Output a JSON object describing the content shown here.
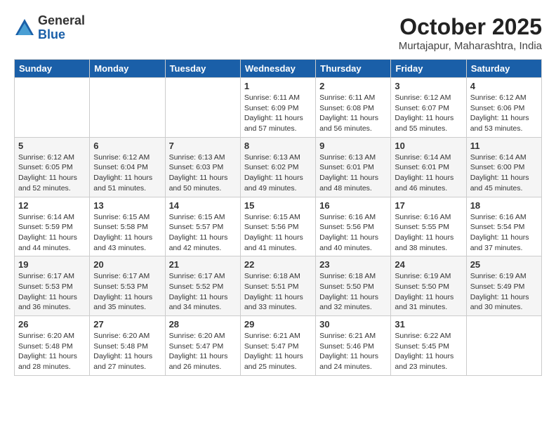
{
  "header": {
    "logo_general": "General",
    "logo_blue": "Blue",
    "month_title": "October 2025",
    "location": "Murtajapur, Maharashtra, India"
  },
  "days_of_week": [
    "Sunday",
    "Monday",
    "Tuesday",
    "Wednesday",
    "Thursday",
    "Friday",
    "Saturday"
  ],
  "weeks": [
    [
      {
        "day": "",
        "info": ""
      },
      {
        "day": "",
        "info": ""
      },
      {
        "day": "",
        "info": ""
      },
      {
        "day": "1",
        "info": "Sunrise: 6:11 AM\nSunset: 6:09 PM\nDaylight: 11 hours\nand 57 minutes."
      },
      {
        "day": "2",
        "info": "Sunrise: 6:11 AM\nSunset: 6:08 PM\nDaylight: 11 hours\nand 56 minutes."
      },
      {
        "day": "3",
        "info": "Sunrise: 6:12 AM\nSunset: 6:07 PM\nDaylight: 11 hours\nand 55 minutes."
      },
      {
        "day": "4",
        "info": "Sunrise: 6:12 AM\nSunset: 6:06 PM\nDaylight: 11 hours\nand 53 minutes."
      }
    ],
    [
      {
        "day": "5",
        "info": "Sunrise: 6:12 AM\nSunset: 6:05 PM\nDaylight: 11 hours\nand 52 minutes."
      },
      {
        "day": "6",
        "info": "Sunrise: 6:12 AM\nSunset: 6:04 PM\nDaylight: 11 hours\nand 51 minutes."
      },
      {
        "day": "7",
        "info": "Sunrise: 6:13 AM\nSunset: 6:03 PM\nDaylight: 11 hours\nand 50 minutes."
      },
      {
        "day": "8",
        "info": "Sunrise: 6:13 AM\nSunset: 6:02 PM\nDaylight: 11 hours\nand 49 minutes."
      },
      {
        "day": "9",
        "info": "Sunrise: 6:13 AM\nSunset: 6:01 PM\nDaylight: 11 hours\nand 48 minutes."
      },
      {
        "day": "10",
        "info": "Sunrise: 6:14 AM\nSunset: 6:01 PM\nDaylight: 11 hours\nand 46 minutes."
      },
      {
        "day": "11",
        "info": "Sunrise: 6:14 AM\nSunset: 6:00 PM\nDaylight: 11 hours\nand 45 minutes."
      }
    ],
    [
      {
        "day": "12",
        "info": "Sunrise: 6:14 AM\nSunset: 5:59 PM\nDaylight: 11 hours\nand 44 minutes."
      },
      {
        "day": "13",
        "info": "Sunrise: 6:15 AM\nSunset: 5:58 PM\nDaylight: 11 hours\nand 43 minutes."
      },
      {
        "day": "14",
        "info": "Sunrise: 6:15 AM\nSunset: 5:57 PM\nDaylight: 11 hours\nand 42 minutes."
      },
      {
        "day": "15",
        "info": "Sunrise: 6:15 AM\nSunset: 5:56 PM\nDaylight: 11 hours\nand 41 minutes."
      },
      {
        "day": "16",
        "info": "Sunrise: 6:16 AM\nSunset: 5:56 PM\nDaylight: 11 hours\nand 40 minutes."
      },
      {
        "day": "17",
        "info": "Sunrise: 6:16 AM\nSunset: 5:55 PM\nDaylight: 11 hours\nand 38 minutes."
      },
      {
        "day": "18",
        "info": "Sunrise: 6:16 AM\nSunset: 5:54 PM\nDaylight: 11 hours\nand 37 minutes."
      }
    ],
    [
      {
        "day": "19",
        "info": "Sunrise: 6:17 AM\nSunset: 5:53 PM\nDaylight: 11 hours\nand 36 minutes."
      },
      {
        "day": "20",
        "info": "Sunrise: 6:17 AM\nSunset: 5:53 PM\nDaylight: 11 hours\nand 35 minutes."
      },
      {
        "day": "21",
        "info": "Sunrise: 6:17 AM\nSunset: 5:52 PM\nDaylight: 11 hours\nand 34 minutes."
      },
      {
        "day": "22",
        "info": "Sunrise: 6:18 AM\nSunset: 5:51 PM\nDaylight: 11 hours\nand 33 minutes."
      },
      {
        "day": "23",
        "info": "Sunrise: 6:18 AM\nSunset: 5:50 PM\nDaylight: 11 hours\nand 32 minutes."
      },
      {
        "day": "24",
        "info": "Sunrise: 6:19 AM\nSunset: 5:50 PM\nDaylight: 11 hours\nand 31 minutes."
      },
      {
        "day": "25",
        "info": "Sunrise: 6:19 AM\nSunset: 5:49 PM\nDaylight: 11 hours\nand 30 minutes."
      }
    ],
    [
      {
        "day": "26",
        "info": "Sunrise: 6:20 AM\nSunset: 5:48 PM\nDaylight: 11 hours\nand 28 minutes."
      },
      {
        "day": "27",
        "info": "Sunrise: 6:20 AM\nSunset: 5:48 PM\nDaylight: 11 hours\nand 27 minutes."
      },
      {
        "day": "28",
        "info": "Sunrise: 6:20 AM\nSunset: 5:47 PM\nDaylight: 11 hours\nand 26 minutes."
      },
      {
        "day": "29",
        "info": "Sunrise: 6:21 AM\nSunset: 5:47 PM\nDaylight: 11 hours\nand 25 minutes."
      },
      {
        "day": "30",
        "info": "Sunrise: 6:21 AM\nSunset: 5:46 PM\nDaylight: 11 hours\nand 24 minutes."
      },
      {
        "day": "31",
        "info": "Sunrise: 6:22 AM\nSunset: 5:45 PM\nDaylight: 11 hours\nand 23 minutes."
      },
      {
        "day": "",
        "info": ""
      }
    ]
  ]
}
